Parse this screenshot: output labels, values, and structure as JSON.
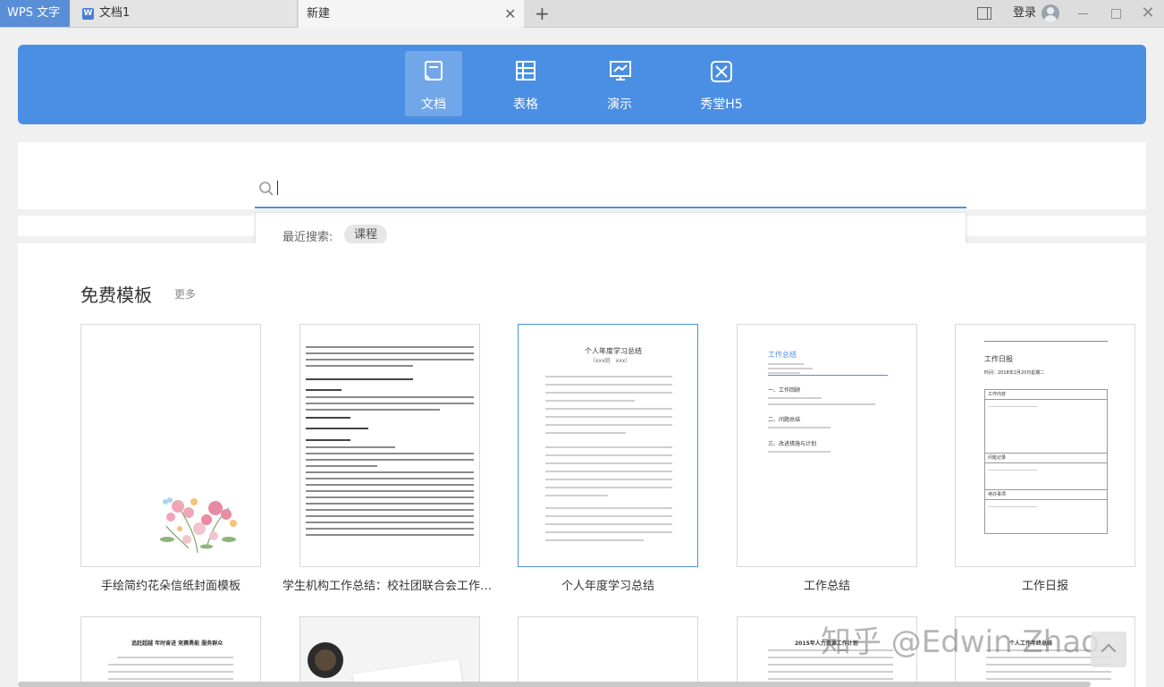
{
  "titlebar": {
    "app_name": "WPS 文字",
    "doc_tab_label": "文档1",
    "new_tab_label": "新建",
    "close_glyph": "✕",
    "plus_glyph": "+",
    "login_label": "登录",
    "close_window_glyph": "✕"
  },
  "categories": [
    {
      "label": "文档",
      "icon": "document-icon",
      "active": true
    },
    {
      "label": "表格",
      "icon": "table-icon",
      "active": false
    },
    {
      "label": "演示",
      "icon": "presentation-icon",
      "active": false
    },
    {
      "label": "秀堂H5",
      "icon": "h5-icon",
      "active": false
    }
  ],
  "search": {
    "value": "",
    "recent_label": "最近搜索:",
    "recent_items": [
      "课程"
    ]
  },
  "section": {
    "title": "免费模板",
    "more_label": "更多"
  },
  "templates": [
    {
      "caption": "手绘简约花朵信纸封面模板"
    },
    {
      "caption": "学生机构工作总结：校社团联合会工作总结"
    },
    {
      "caption": "个人年度学习总结",
      "selected": true
    },
    {
      "caption": "工作总结"
    },
    {
      "caption": "工作日报"
    }
  ],
  "thumb_texts": {
    "t3_title": "个人年度学习总结",
    "t3_sub": "（xxx班　xxx）",
    "t4_title": "工作总结",
    "t4_s1": "一、工作回顾",
    "t4_s2": "二、问题总结",
    "t4_s3": "三、改进措施与计划",
    "t5_title": "工作日报",
    "t5_date": "时间：2018年2月20日星期二",
    "t5_a": "工作内容",
    "t5_b": "问题记录",
    "t5_c": "待办事项",
    "r2_1_title": "追赶超越 年时奋进 竞赛勇能 服务群众",
    "r2_4_title": "2015年人力资源工作计划",
    "r2_5_title": "个人工作年终总结"
  },
  "watermark": "知乎 @Edwin Zhao",
  "colors": {
    "accent": "#4a8fe3",
    "app_tab": "#5a8fd8"
  }
}
